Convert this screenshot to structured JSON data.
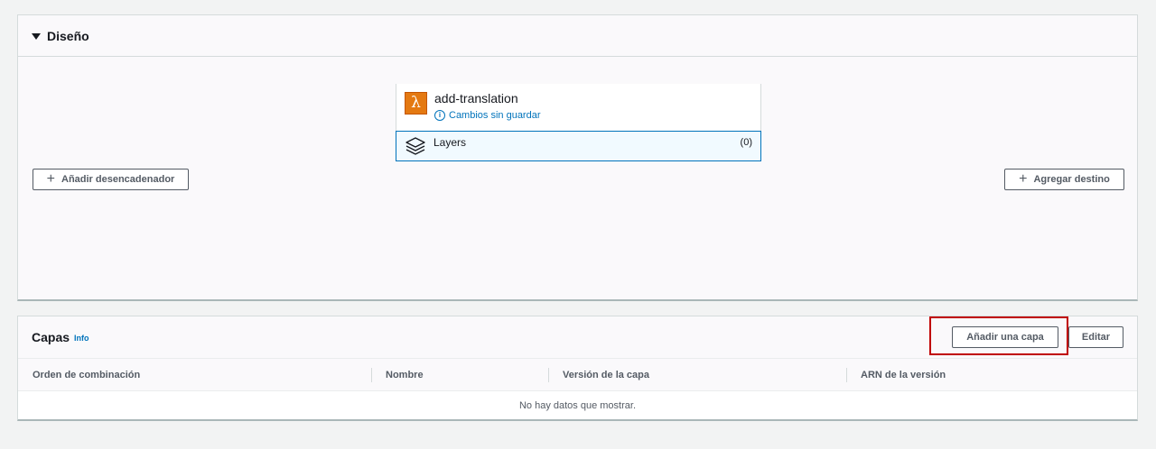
{
  "design": {
    "title": "Diseño",
    "function": {
      "name": "add-translation",
      "status": "Cambios sin guardar",
      "status_icon": "info-icon",
      "icon": "lambda-icon",
      "icon_glyph": "λ"
    },
    "layers": {
      "label": "Layers",
      "count": "(0)",
      "icon": "layers-icon"
    },
    "add_trigger_label": "Añadir desencadenador",
    "add_destination_label": "Agregar destino"
  },
  "layers_panel": {
    "title": "Capas",
    "info_label": "Info",
    "add_layer_label": "Añadir una capa",
    "edit_label": "Editar",
    "columns": [
      "Orden de combinación",
      "Nombre",
      "Versión de la capa",
      "ARN de la versión"
    ],
    "empty_message": "No hay datos que mostrar."
  },
  "colors": {
    "accent": "#0073bb",
    "lambda_orange": "#e47911",
    "highlight": "#c00000"
  }
}
